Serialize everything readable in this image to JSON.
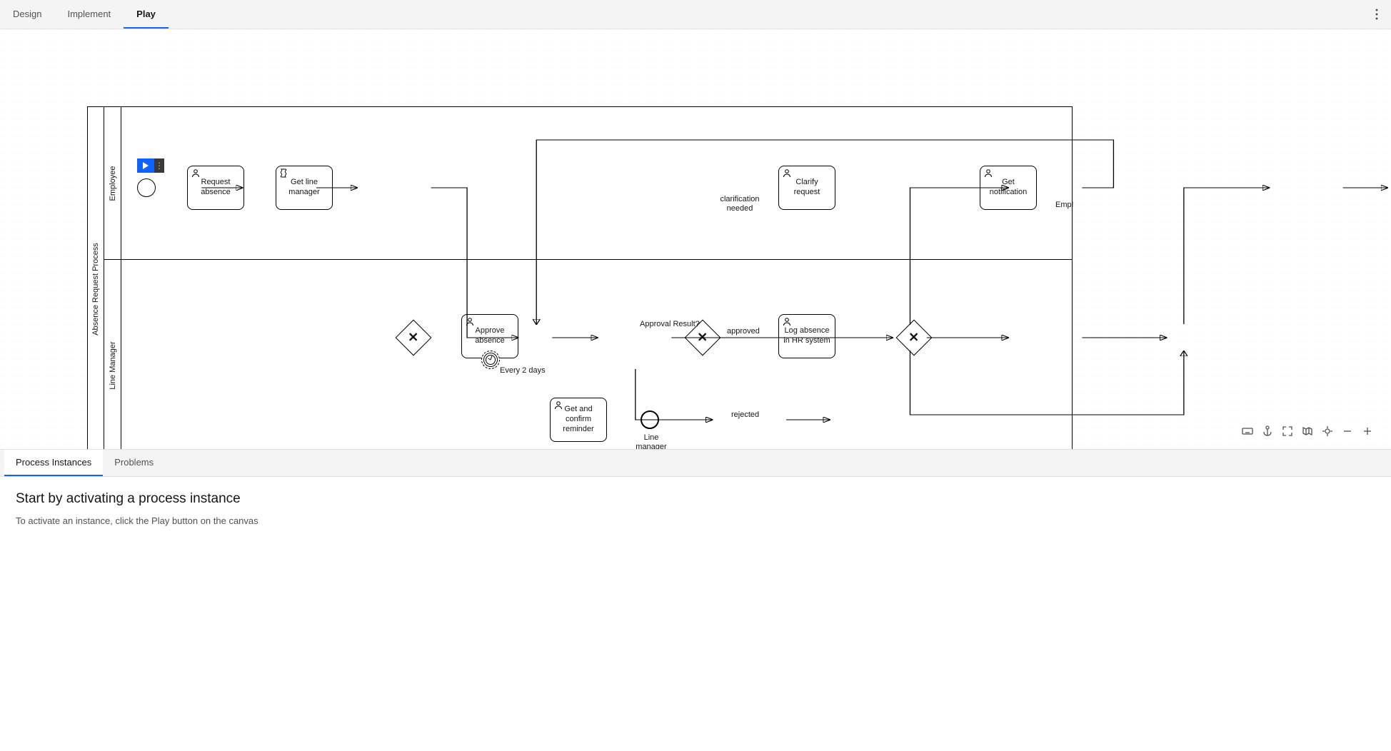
{
  "tabs": {
    "design": "Design",
    "implement": "Implement",
    "play": "Play"
  },
  "pool": {
    "title": "Absence Request Process"
  },
  "lanes": {
    "employee": "Employee",
    "lineManager": "Line Manager"
  },
  "tasks": {
    "requestAbsence": "Request absence",
    "getLineManager": "Get line manager",
    "approveAbsence": "Approve absence",
    "getConfirmReminder": "Get and confirm reminder",
    "clarifyRequest": "Clarify request",
    "logAbsence": "Log absence in HR system",
    "getNotification": "Get notification"
  },
  "labels": {
    "every2days": "Every 2 days",
    "approvalResult": "Approval Result?",
    "clarificationNeeded": "clarification needed",
    "approved": "approved",
    "rejected": "rejected",
    "lineManagerReminded": "Line manager reminded",
    "empl": "Empl"
  },
  "bottomTabs": {
    "processInstances": "Process Instances",
    "problems": "Problems"
  },
  "bottom": {
    "heading": "Start by activating a process instance",
    "sub": "To activate an instance, click the Play button on the canvas"
  }
}
